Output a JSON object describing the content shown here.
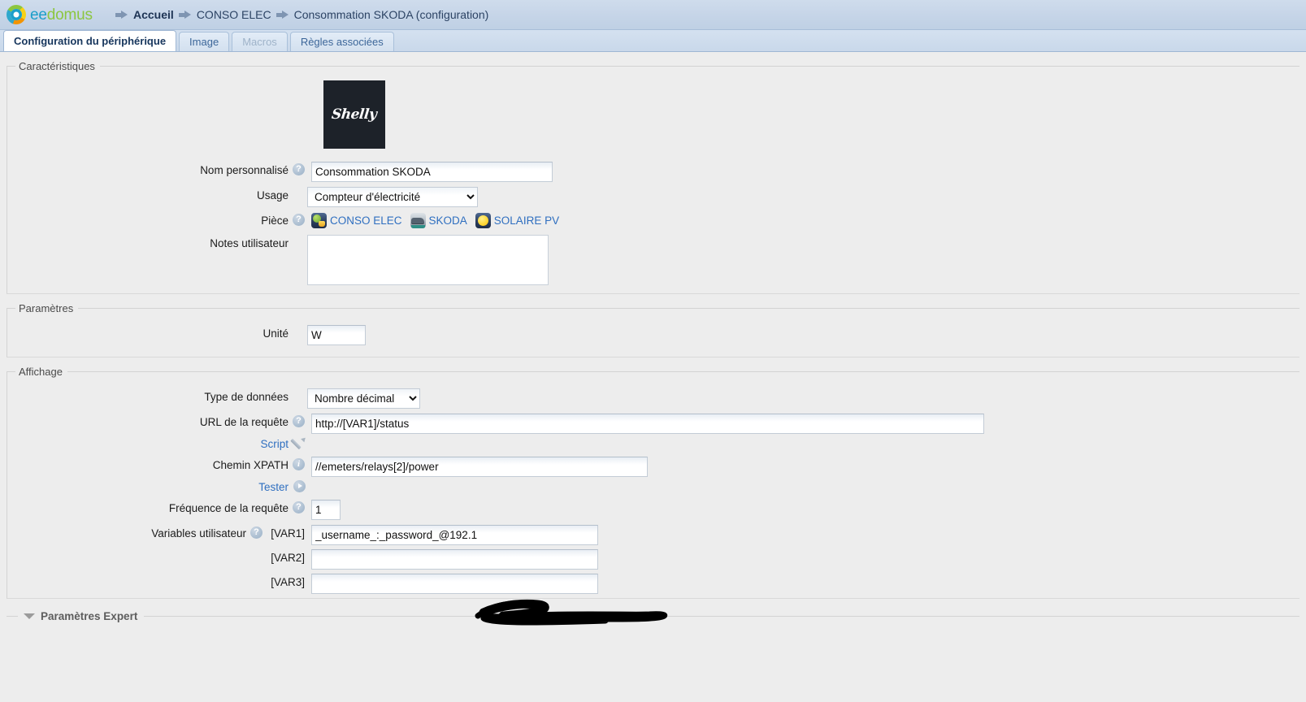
{
  "header": {
    "brand_prefix": "ee",
    "brand_suffix": "domus",
    "breadcrumb": [
      {
        "label": "Accueil",
        "strong": true,
        "link": true
      },
      {
        "label": "CONSO ELEC",
        "strong": false,
        "link": true
      },
      {
        "label": "Consommation SKODA (configuration)",
        "strong": false,
        "link": false
      }
    ]
  },
  "tabs": [
    {
      "label": "Configuration du périphérique",
      "state": "active"
    },
    {
      "label": "Image",
      "state": "normal"
    },
    {
      "label": "Macros",
      "state": "disabled"
    },
    {
      "label": "Règles associées",
      "state": "normal"
    }
  ],
  "sections": {
    "caracteristiques": {
      "legend": "Caractéristiques",
      "device_image_alt": "Shelly",
      "nom_personnalise": {
        "label": "Nom personnalisé",
        "help": "?",
        "value": "Consommation SKODA"
      },
      "usage": {
        "label": "Usage",
        "value": "Compteur d'électricité",
        "options": [
          "Compteur d'électricité"
        ]
      },
      "piece": {
        "label": "Pièce",
        "help": "?",
        "rooms": [
          {
            "name": "CONSO ELEC",
            "icon": "plug-icon"
          },
          {
            "name": "SKODA",
            "icon": "car-icon"
          },
          {
            "name": "SOLAIRE PV",
            "icon": "sun-icon"
          }
        ]
      },
      "notes": {
        "label": "Notes utilisateur",
        "value": "",
        "placeholder": ""
      }
    },
    "parametres": {
      "legend": "Paramètres",
      "unite": {
        "label": "Unité",
        "value": "W"
      }
    },
    "affichage": {
      "legend": "Affichage",
      "type_donnees": {
        "label": "Type de données",
        "value": "Nombre décimal",
        "options": [
          "Nombre décimal"
        ]
      },
      "url_requete": {
        "label": "URL de la requête",
        "help": "?",
        "value": "http://[VAR1]/status"
      },
      "script": {
        "label": "Script",
        "icon": "pencil-icon"
      },
      "chemin_xpath": {
        "label": "Chemin XPATH",
        "help": "i",
        "value": "//emeters/relays[2]/power"
      },
      "tester": {
        "label": "Tester",
        "icon": "play-icon"
      },
      "frequence": {
        "label": "Fréquence de la requête",
        "help": "?",
        "value": "1"
      },
      "variables": {
        "label": "Variables utilisateur",
        "help": "?",
        "items": [
          {
            "tag": "[VAR1]",
            "value": "_username_:_password_@192.1",
            "redacted": true
          },
          {
            "tag": "[VAR2]",
            "value": "",
            "redacted": false
          },
          {
            "tag": "[VAR3]",
            "value": "",
            "redacted": false
          }
        ]
      }
    }
  },
  "expert": {
    "label": "Paramètres Expert",
    "icon": "triangle-down-icon"
  },
  "colors": {
    "page_bg": "#ededed",
    "header_bg": "#c6d5e8",
    "tab_active_bg": "#ffffff",
    "link_blue": "#2f6fc0",
    "brand_green": "#8cc63f",
    "brand_blue": "#1b9ec9",
    "redaction": "#000000"
  }
}
